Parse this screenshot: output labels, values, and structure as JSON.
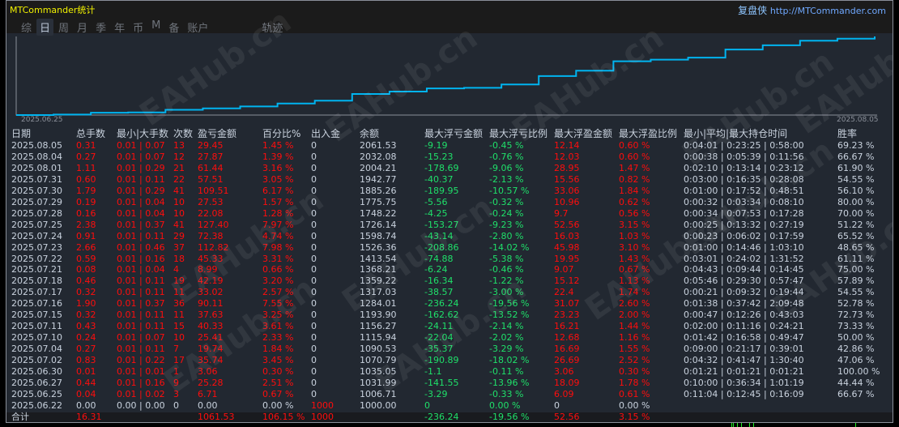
{
  "header": {
    "title": "MTCommander统计",
    "brand": "复盘侠",
    "url": "http://MTCommander.com",
    "watermark": "EAHub.cn"
  },
  "tabs": [
    {
      "label": "综",
      "active": false
    },
    {
      "label": "日",
      "active": true
    },
    {
      "label": "周",
      "active": false
    },
    {
      "label": "月",
      "active": false
    },
    {
      "label": "季",
      "active": false
    },
    {
      "label": "年",
      "active": false
    },
    {
      "label": "币",
      "active": false
    },
    {
      "label": "M",
      "active": false
    },
    {
      "label": "备",
      "active": false
    },
    {
      "label": "账户",
      "active": false
    },
    {
      "label": "轨迹",
      "active": false
    }
  ],
  "chart": {
    "start_label": "2025.06.25",
    "end_label": "2025.08.05",
    "line_color": "#00b4f0"
  },
  "table": {
    "columns": [
      "日期",
      "总手数",
      "最小|大手数",
      "次数",
      "盈亏金额",
      "百分比%",
      "出入金",
      "余额",
      "最大浮亏金额",
      "最大浮亏比例",
      "最大浮盈金额",
      "最大浮盈比例",
      "最小|平均|最大持仓时间",
      "胜率"
    ],
    "rows": [
      [
        "2025.08.05",
        "0.31",
        "0.01 | 0.07",
        "13",
        "29.45",
        "1.45 %",
        "0",
        "2061.53",
        "-9.19",
        "-0.45 %",
        "12.14",
        "0.60 %",
        "0:04:01 | 0:23:25 | 0:58:00",
        "69.23 %"
      ],
      [
        "2025.08.04",
        "0.27",
        "0.01 | 0.07",
        "12",
        "27.87",
        "1.39 %",
        "0",
        "2032.08",
        "-15.23",
        "-0.76 %",
        "12.03",
        "0.60 %",
        "0:00:38 | 0:05:39 | 0:11:56",
        "66.67 %"
      ],
      [
        "2025.08.01",
        "1.11",
        "0.01 | 0.29",
        "21",
        "61.44",
        "3.16 %",
        "0",
        "2004.21",
        "-178.69",
        "-9.06 %",
        "28.95",
        "1.47 %",
        "0:02:10 | 0:13:14 | 0:23:12",
        "61.90 %"
      ],
      [
        "2025.07.31",
        "0.60",
        "0.01 | 0.11",
        "22",
        "57.51",
        "3.05 %",
        "0",
        "1942.77",
        "-40.37",
        "-2.13 %",
        "15.56",
        "0.82 %",
        "0:03:00 | 0:16:35 | 0:28:08",
        "54.55 %"
      ],
      [
        "2025.07.30",
        "1.79",
        "0.01 | 0.29",
        "41",
        "109.51",
        "6.17 %",
        "0",
        "1885.26",
        "-189.95",
        "-10.57 %",
        "33.06",
        "1.84 %",
        "0:01:00 | 0:17:52 | 0:48:51",
        "56.10 %"
      ],
      [
        "2025.07.29",
        "0.19",
        "0.01 | 0.04",
        "10",
        "27.53",
        "1.57 %",
        "0",
        "1775.75",
        "-5.56",
        "-0.32 %",
        "10.96",
        "0.62 %",
        "0:00:32 | 0:03:34 | 0:08:10",
        "80.00 %"
      ],
      [
        "2025.07.28",
        "0.16",
        "0.01 | 0.04",
        "10",
        "22.08",
        "1.28 %",
        "0",
        "1748.22",
        "-4.25",
        "-0.24 %",
        "9.7",
        "0.56 %",
        "0:00:34 | 0:07:53 | 0:17:28",
        "70.00 %"
      ],
      [
        "2025.07.25",
        "2.38",
        "0.01 | 0.37",
        "41",
        "127.40",
        "7.97 %",
        "0",
        "1726.14",
        "-153.27",
        "-9.23 %",
        "52.56",
        "3.15 %",
        "0:00:25 | 0:13:32 | 0:27:19",
        "51.22 %"
      ],
      [
        "2025.07.24",
        "0.91",
        "0.01 | 0.11",
        "29",
        "72.38",
        "4.74 %",
        "0",
        "1598.74",
        "-43.14",
        "-2.80 %",
        "16.03",
        "1.03 %",
        "0:00:23 | 0:06:02 | 0:17:59",
        "65.52 %"
      ],
      [
        "2025.07.23",
        "2.66",
        "0.01 | 0.46",
        "37",
        "112.82",
        "7.98 %",
        "0",
        "1526.36",
        "-208.86",
        "-14.02 %",
        "45.98",
        "3.10 %",
        "0:01:00 | 0:14:46 | 1:03:10",
        "48.65 %"
      ],
      [
        "2025.07.22",
        "0.59",
        "0.01 | 0.16",
        "18",
        "45.33",
        "3.31 %",
        "0",
        "1413.54",
        "-74.88",
        "-5.38 %",
        "19.95",
        "1.43 %",
        "0:03:01 | 0:24:02 | 1:31:52",
        "61.11 %"
      ],
      [
        "2025.07.21",
        "0.08",
        "0.01 | 0.04",
        "4",
        "8.99",
        "0.66 %",
        "0",
        "1368.21",
        "-6.24",
        "-0.46 %",
        "9.07",
        "0.67 %",
        "0:04:43 | 0:09:44 | 0:14:45",
        "75.00 %"
      ],
      [
        "2025.07.18",
        "0.46",
        "0.01 | 0.11",
        "19",
        "42.19",
        "3.20 %",
        "0",
        "1359.22",
        "-16.34",
        "-1.22 %",
        "15.12",
        "1.13 %",
        "0:05:46 | 0:29:30 | 0:57:47",
        "57.89 %"
      ],
      [
        "2025.07.17",
        "0.32",
        "0.01 | 0.11",
        "11",
        "33.02",
        "2.57 %",
        "0",
        "1317.03",
        "-38.57",
        "-3.00 %",
        "22.4",
        "1.74 %",
        "0:00:21 | 0:09:32 | 0:19:44",
        "54.55 %"
      ],
      [
        "2025.07.16",
        "1.90",
        "0.01 | 0.37",
        "36",
        "90.11",
        "7.55 %",
        "0",
        "1284.01",
        "-236.24",
        "-19.56 %",
        "31.07",
        "2.60 %",
        "0:01:38 | 0:37:42 | 2:09:48",
        "52.78 %"
      ],
      [
        "2025.07.15",
        "0.32",
        "0.01 | 0.11",
        "11",
        "37.63",
        "3.25 %",
        "0",
        "1193.90",
        "-162.62",
        "-13.52 %",
        "23.23",
        "2.00 %",
        "0:00:47 | 0:12:26 | 0:43:03",
        "72.73 %"
      ],
      [
        "2025.07.11",
        "0.43",
        "0.01 | 0.11",
        "15",
        "40.33",
        "3.61 %",
        "0",
        "1156.27",
        "-24.11",
        "-2.14 %",
        "16.21",
        "1.44 %",
        "0:02:00 | 0:11:16 | 0:24:21",
        "73.33 %"
      ],
      [
        "2025.07.10",
        "0.24",
        "0.01 | 0.07",
        "10",
        "25.41",
        "2.33 %",
        "0",
        "1115.94",
        "-22.04",
        "-2.02 %",
        "12.68",
        "1.16 %",
        "0:01:42 | 0:16:58 | 0:49:47",
        "50.00 %"
      ],
      [
        "2025.07.04",
        "0.27",
        "0.01 | 0.11",
        "7",
        "19.74",
        "1.84 %",
        "0",
        "1090.53",
        "-35.37",
        "-3.29 %",
        "16.69",
        "1.55 %",
        "0:09:00 | 0:21:17 | 0:39:01",
        "42.86 %"
      ],
      [
        "2025.07.02",
        "0.83",
        "0.01 | 0.22",
        "17",
        "35.74",
        "3.45 %",
        "0",
        "1070.79",
        "-190.89",
        "-18.02 %",
        "26.69",
        "2.52 %",
        "0:04:32 | 0:41:47 | 1:30:40",
        "47.06 %"
      ],
      [
        "2025.06.30",
        "0.01",
        "0.01 | 0.01",
        "1",
        "3.06",
        "0.30 %",
        "0",
        "1035.05",
        "-1.1",
        "-0.11 %",
        "3.06",
        "0.30 %",
        "0:01:21 | 0:01:21 | 0:01:21",
        "100.00 %"
      ],
      [
        "2025.06.27",
        "0.44",
        "0.01 | 0.16",
        "9",
        "25.28",
        "2.51 %",
        "0",
        "1031.99",
        "-141.55",
        "-13.96 %",
        "18.09",
        "1.78 %",
        "0:10:00 | 0:36:34 | 1:01:19",
        "44.44 %"
      ],
      [
        "2025.06.25",
        "0.04",
        "0.01 | 0.02",
        "3",
        "6.71",
        "0.67 %",
        "0",
        "1006.71",
        "-3.29",
        "-0.33 %",
        "6.09",
        "0.61 %",
        "0:11:04 | 0:12:45 | 0:16:09",
        "66.67 %"
      ],
      [
        "2025.06.22",
        "0.00",
        "0.00 | 0.00",
        "0",
        "0.00",
        "0.00 %",
        "1000",
        "1000.00",
        "0",
        "0.00 %",
        "0",
        "0.00 %",
        "",
        ""
      ]
    ],
    "totals": [
      "合计",
      "16.31",
      "",
      "",
      "1061.53",
      "106.15 %",
      "1000",
      "",
      "-236.24",
      "-19.56 %",
      "52.56",
      "3.15 %",
      "",
      ""
    ]
  },
  "colors": {
    "positive": "#ff0d0d",
    "negative": "#1fe06a",
    "neutral": "#c9d2de",
    "title": "#f2f200"
  }
}
